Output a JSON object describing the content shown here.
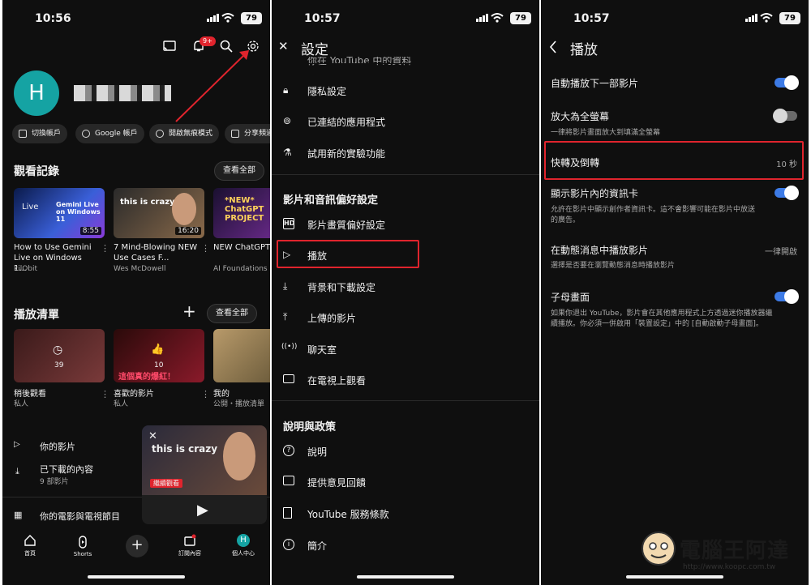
{
  "panel1": {
    "status": {
      "time": "10:56",
      "battery": "79"
    },
    "notifications_badge": "9+",
    "profile": {
      "avatar_letter": "H",
      "avatar_color": "#15a3a3"
    },
    "chips": [
      "切換帳戶",
      "Google 帳戶",
      "開啟無痕模式",
      "分享頻道"
    ],
    "history": {
      "title": "觀看記錄",
      "view_all": "查看全部",
      "videos": [
        {
          "thumb_text": "Gemini Live on Windows 11",
          "thumb_tag": "Live",
          "duration": "8:55",
          "title": "How to Use Gemini Live on Windows 1...",
          "channel": "kilObit"
        },
        {
          "thumb_text": "this is crazy",
          "duration": "16:20",
          "title": "7 Mind-Blowing NEW Use Cases F...",
          "channel": "Wes McDowell"
        },
        {
          "thumb_text": "*NEW* ChatGPT PROJECT",
          "duration": "",
          "title": "NEW ChatGPT Projects Full G",
          "channel": "AI Foundations"
        }
      ]
    },
    "playlists": {
      "title": "播放清單",
      "view_all": "查看全部",
      "items": [
        {
          "count": "39",
          "title": "稍後觀看",
          "sub": "私人"
        },
        {
          "count": "10",
          "thumb_text": "這個真的爆紅！",
          "title": "喜歡的影片",
          "sub": "私人"
        },
        {
          "count": "",
          "title": "我的",
          "sub": "公開・播放清單"
        }
      ]
    },
    "list": [
      {
        "label": "你的影片",
        "sub": ""
      },
      {
        "label": "已下載的內容",
        "sub": "9 部影片"
      },
      {
        "label": "你的電影與電視節目",
        "sub": ""
      }
    ],
    "mini_player": {
      "thumb_text": "this is crazy",
      "badge": "繼續觀看"
    },
    "nav": [
      "首頁",
      "Shorts",
      "",
      "訂閱內容",
      "個人中心"
    ]
  },
  "panel2": {
    "status": {
      "time": "10:57",
      "battery": "79"
    },
    "title": "設定",
    "partial_top": "你在 YouTube 中的資料",
    "group1": [
      "隱私設定",
      "已連結的應用程式",
      "試用新的實驗功能"
    ],
    "section1": "影片和音訊偏好設定",
    "group2": [
      "影片畫質偏好設定",
      "播放",
      "背景和下載設定",
      "上傳的影片",
      "聊天室",
      "在電視上觀看"
    ],
    "section2": "說明與政策",
    "group3": [
      "說明",
      "提供意見回饋",
      "YouTube 服務條款",
      "簡介"
    ]
  },
  "panel3": {
    "status": {
      "time": "10:57",
      "battery": "79"
    },
    "title": "播放",
    "rows": [
      {
        "label": "自動播放下一部影片",
        "desc": "",
        "toggle": "on",
        "value": ""
      },
      {
        "label": "放大為全螢幕",
        "desc": "一律將影片畫面放大到填滿全螢幕",
        "toggle": "off",
        "value": ""
      },
      {
        "label": "快轉及倒轉",
        "desc": "",
        "toggle": "",
        "value": "10 秒"
      },
      {
        "label": "顯示影片內的資訊卡",
        "desc": "允許在影片中顯示創作者資訊卡。這不會影響可能在影片中放送的廣告。",
        "toggle": "on",
        "value": ""
      },
      {
        "label": "在動態消息中播放影片",
        "desc": "選擇是否要在瀏覽動態消息時播放影片",
        "toggle": "",
        "value": "一律開啟"
      },
      {
        "label": "子母畫面",
        "desc": "如果你退出 YouTube，影片會在其他應用程式上方透過迷你播放器繼續播放。你必須一併啟用「裝置設定」中的 [自動啟動子母畫面]。",
        "toggle": "on",
        "value": ""
      }
    ]
  },
  "watermark": {
    "title": "電腦王阿達",
    "url": "http://www.koopc.com.tw"
  },
  "colors": {
    "background": "#0f0f0f",
    "accent_blue": "#3d7be6",
    "highlight_red": "#e0242d",
    "badge_red": "#e0242d"
  }
}
